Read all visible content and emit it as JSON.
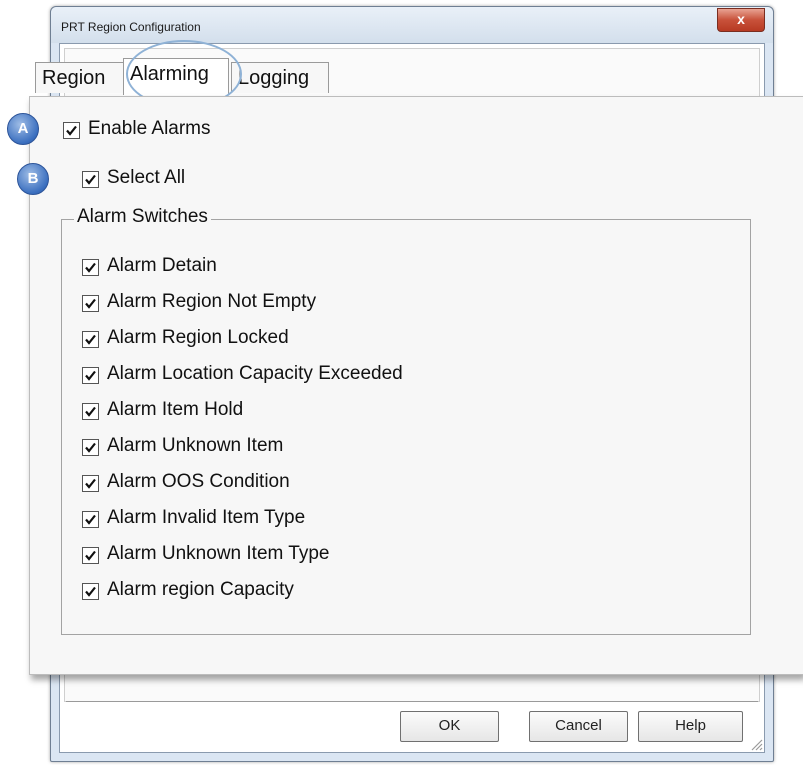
{
  "window": {
    "title": "PRT Region Configuration",
    "close_label": "x"
  },
  "tabs": [
    {
      "label": "Region",
      "selected": false
    },
    {
      "label": "Alarming",
      "selected": true
    },
    {
      "label": "Logging",
      "selected": false
    }
  ],
  "markers": {
    "a": "A",
    "b": "B"
  },
  "enable_alarms": {
    "label": "Enable Alarms",
    "checked": true
  },
  "select_all": {
    "label": "Select All",
    "checked": true
  },
  "alarm_switches": {
    "label": "Alarm Switches",
    "items": [
      {
        "label": "Alarm Detain",
        "checked": true
      },
      {
        "label": "Alarm Region Not Empty",
        "checked": true
      },
      {
        "label": "Alarm Region Locked",
        "checked": true
      },
      {
        "label": "Alarm Location Capacity Exceeded",
        "checked": true
      },
      {
        "label": "Alarm Item Hold",
        "checked": true
      },
      {
        "label": "Alarm Unknown Item",
        "checked": true
      },
      {
        "label": "Alarm OOS Condition",
        "checked": true
      },
      {
        "label": "Alarm Invalid Item Type",
        "checked": true
      },
      {
        "label": "Alarm Unknown Item Type",
        "checked": true
      },
      {
        "label": "Alarm region Capacity",
        "checked": true
      }
    ]
  },
  "buttons": {
    "ok": "OK",
    "cancel": "Cancel",
    "help": "Help"
  }
}
